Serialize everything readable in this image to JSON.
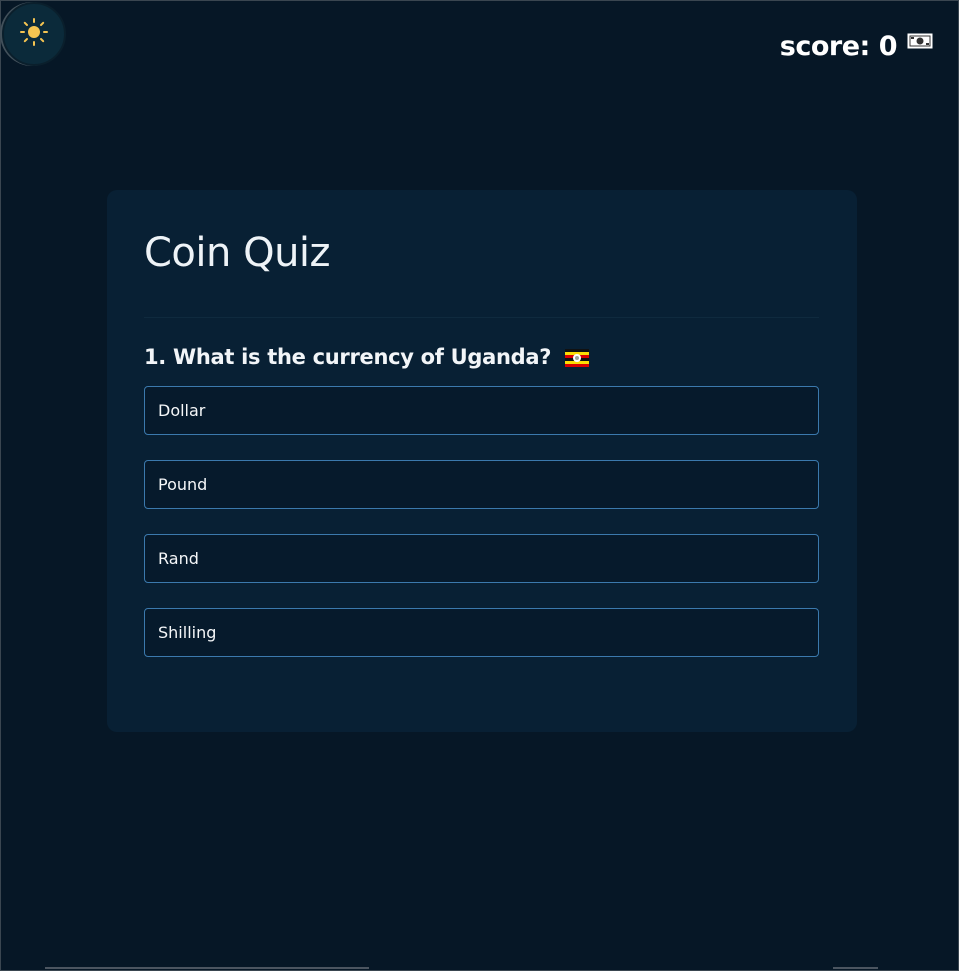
{
  "header": {
    "theme_toggle_icon": "sun-icon",
    "score_label": "score: 0",
    "score_icon": "money-icon"
  },
  "quiz": {
    "title": "Coin Quiz",
    "question": "1. What is the currency of Uganda?",
    "question_flag": "uganda-flag",
    "options": [
      "Dollar",
      "Pound",
      "Rand",
      "Shilling"
    ]
  },
  "colors": {
    "background": "#061726",
    "card": "#082034",
    "option_border": "#3b79ad",
    "sun": "#f5c451"
  }
}
